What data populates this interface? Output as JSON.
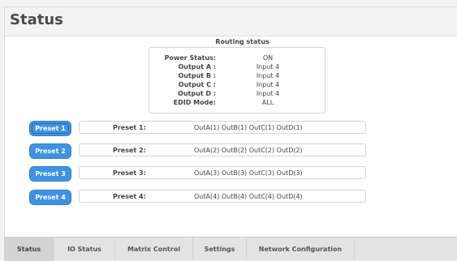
{
  "page": {
    "title": "Status"
  },
  "routing": {
    "title": "Routing status",
    "rows": [
      {
        "label": "Power Status:",
        "value": "ON"
      },
      {
        "label": "Output A :",
        "value": "Input 4"
      },
      {
        "label": "Output B :",
        "value": "Input 4"
      },
      {
        "label": "Output C :",
        "value": "Input 4"
      },
      {
        "label": "Output D :",
        "value": "Input 4"
      },
      {
        "label": "EDID Mode:",
        "value": "ALL"
      }
    ]
  },
  "presets": [
    {
      "button": "Preset 1",
      "label": "Preset 1:",
      "value": "OutA(1) OutB(1) OutC(1) OutD(1)"
    },
    {
      "button": "Preset 2",
      "label": "Preset 2:",
      "value": "OutA(2) OutB(2) OutC(2) OutD(2)"
    },
    {
      "button": "Preset 3",
      "label": "Preset 3:",
      "value": "OutA(3) OutB(3) OutC(3) OutD(3)"
    },
    {
      "button": "Preset 4",
      "label": "Preset 4:",
      "value": "OutA(4) OutB(4) OutC(4) OutD(4)"
    }
  ],
  "tabs": [
    {
      "label": "Status",
      "active": true
    },
    {
      "label": "IO Status"
    },
    {
      "label": "Matrix Control"
    },
    {
      "label": "Settings"
    },
    {
      "label": "Network Configuration"
    }
  ],
  "colors": {
    "accent": "#3f93e2",
    "active_tab": "#d3d3d3"
  }
}
